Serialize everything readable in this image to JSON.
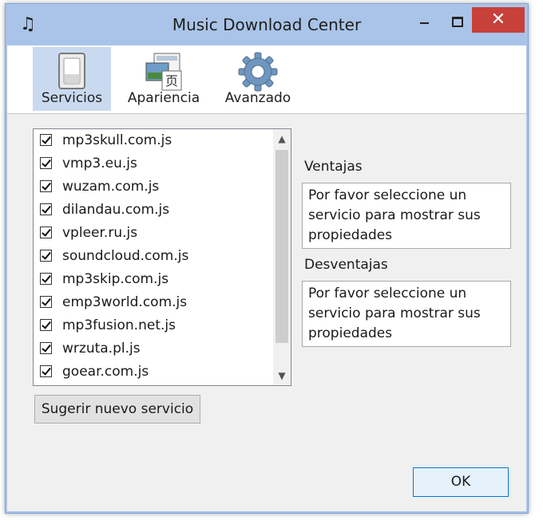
{
  "window": {
    "title": "Music Download Center"
  },
  "titlebar": {
    "icon": "music-note-icon",
    "close_glyph": "✕"
  },
  "toolbar": {
    "tabs": [
      {
        "label": "Servicios",
        "icon": "toggle-switch-icon",
        "active": true
      },
      {
        "label": "Apariencia",
        "icon": "image-text-icon",
        "active": false
      },
      {
        "label": "Avanzado",
        "icon": "gear-icon",
        "active": false
      }
    ]
  },
  "services": {
    "items": [
      {
        "label": "mp3skull.com.js",
        "checked": true
      },
      {
        "label": "vmp3.eu.js",
        "checked": true
      },
      {
        "label": "wuzam.com.js",
        "checked": true
      },
      {
        "label": "dilandau.com.js",
        "checked": true
      },
      {
        "label": "vpleer.ru.js",
        "checked": true
      },
      {
        "label": "soundcloud.com.js",
        "checked": true
      },
      {
        "label": "mp3skip.com.js",
        "checked": true
      },
      {
        "label": "emp3world.com.js",
        "checked": true
      },
      {
        "label": "mp3fusion.net.js",
        "checked": true
      },
      {
        "label": "wrzuta.pl.js",
        "checked": true
      },
      {
        "label": "goear.com.js",
        "checked": true
      }
    ],
    "suggest_label": "Sugerir nuevo servicio"
  },
  "details": {
    "advantages_label": "Ventajas",
    "advantages_text": "Por favor seleccione un servicio para mostrar sus propiedades",
    "disadvantages_label": "Desventajas",
    "disadvantages_text": "Por favor seleccione un servicio para mostrar sus propiedades"
  },
  "footer": {
    "ok_label": "OK"
  }
}
